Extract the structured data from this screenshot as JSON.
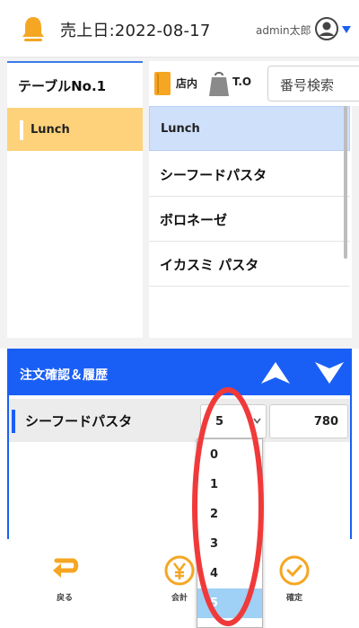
{
  "header": {
    "sales_date": "売上日:2022-08-17",
    "user_name": "admin太郎",
    "bell_icon": "bell-icon",
    "avatar_icon": "user-avatar-icon"
  },
  "left": {
    "table_tab": "テーブルNo.1",
    "categories": [
      "Lunch"
    ]
  },
  "mode": {
    "dine_in": "店内",
    "take_out": "T.O",
    "search_label": "番号検索"
  },
  "menu": {
    "header": "Lunch",
    "items": [
      "シーフードパスタ",
      "ボロネーゼ",
      "イカスミ パスタ"
    ]
  },
  "order": {
    "title": "注文確認＆履歴",
    "row": {
      "name": "シーフードパスタ",
      "quantity": "5",
      "price": "780"
    },
    "quantity_options": [
      "0",
      "1",
      "2",
      "3",
      "4",
      "5"
    ],
    "selected_quantity": "5"
  },
  "toolbar": {
    "back": "戻る",
    "checkout": "会計",
    "confirm": "確定"
  },
  "colors": {
    "accent": "#1a5ff5",
    "category_highlight": "#fdd27a",
    "icon_orange": "#f5a623",
    "annotation_red": "#f03a3a"
  }
}
